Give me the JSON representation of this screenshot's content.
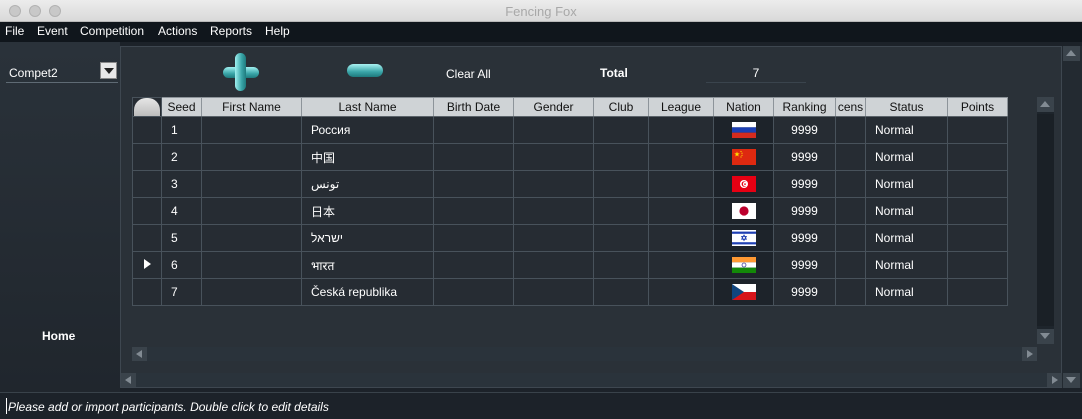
{
  "window": {
    "title": "Fencing Fox"
  },
  "menu": [
    "File",
    "Event",
    "Competition",
    "Actions",
    "Reports",
    "Help"
  ],
  "sidebar": {
    "competition_selected": "Compet2",
    "home_label": "Home"
  },
  "toolbar": {
    "clear_all_label": "Clear All",
    "total_label": "Total",
    "total_value": "7"
  },
  "columns": [
    "Seed",
    "First Name",
    "Last Name",
    "Birth Date",
    "Gender",
    "Club",
    "League",
    "Nation",
    "Ranking",
    "cens",
    "Status",
    "Points"
  ],
  "rows": [
    {
      "seed": "1",
      "first_name": "",
      "last_name": "Россия",
      "birth_date": "",
      "gender": "",
      "club": "",
      "league": "",
      "nation_flag": "russia-flag-icon",
      "ranking": "9999",
      "licence": "",
      "status": "Normal",
      "points": "",
      "selected": false
    },
    {
      "seed": "2",
      "first_name": "",
      "last_name": "中国",
      "birth_date": "",
      "gender": "",
      "club": "",
      "league": "",
      "nation_flag": "china-flag-icon",
      "ranking": "9999",
      "licence": "",
      "status": "Normal",
      "points": "",
      "selected": false
    },
    {
      "seed": "3",
      "first_name": "",
      "last_name": "تونس",
      "birth_date": "",
      "gender": "",
      "club": "",
      "league": "",
      "nation_flag": "tunisia-flag-icon",
      "ranking": "9999",
      "licence": "",
      "status": "Normal",
      "points": "",
      "selected": false
    },
    {
      "seed": "4",
      "first_name": "",
      "last_name": "日本",
      "birth_date": "",
      "gender": "",
      "club": "",
      "league": "",
      "nation_flag": "japan-flag-icon",
      "ranking": "9999",
      "licence": "",
      "status": "Normal",
      "points": "",
      "selected": false
    },
    {
      "seed": "5",
      "first_name": "",
      "last_name": "ישראל",
      "birth_date": "",
      "gender": "",
      "club": "",
      "league": "",
      "nation_flag": "israel-flag-icon",
      "ranking": "9999",
      "licence": "",
      "status": "Normal",
      "points": "",
      "selected": false
    },
    {
      "seed": "6",
      "first_name": "",
      "last_name": "भारत",
      "birth_date": "",
      "gender": "",
      "club": "",
      "league": "",
      "nation_flag": "india-flag-icon",
      "ranking": "9999",
      "licence": "",
      "status": "Normal",
      "points": "",
      "selected": true
    },
    {
      "seed": "7",
      "first_name": "",
      "last_name": "Česká republika",
      "birth_date": "",
      "gender": "",
      "club": "",
      "league": "",
      "nation_flag": "czech-flag-icon",
      "ranking": "9999",
      "licence": "",
      "status": "Normal",
      "points": "",
      "selected": false
    }
  ],
  "status_bar": {
    "message": "Please add or import participants. Double click to edit details"
  },
  "colors": {
    "accent_teal": "#3aa5a8",
    "header_bg": "#cfd3d6",
    "row_bg": "#262c33"
  }
}
